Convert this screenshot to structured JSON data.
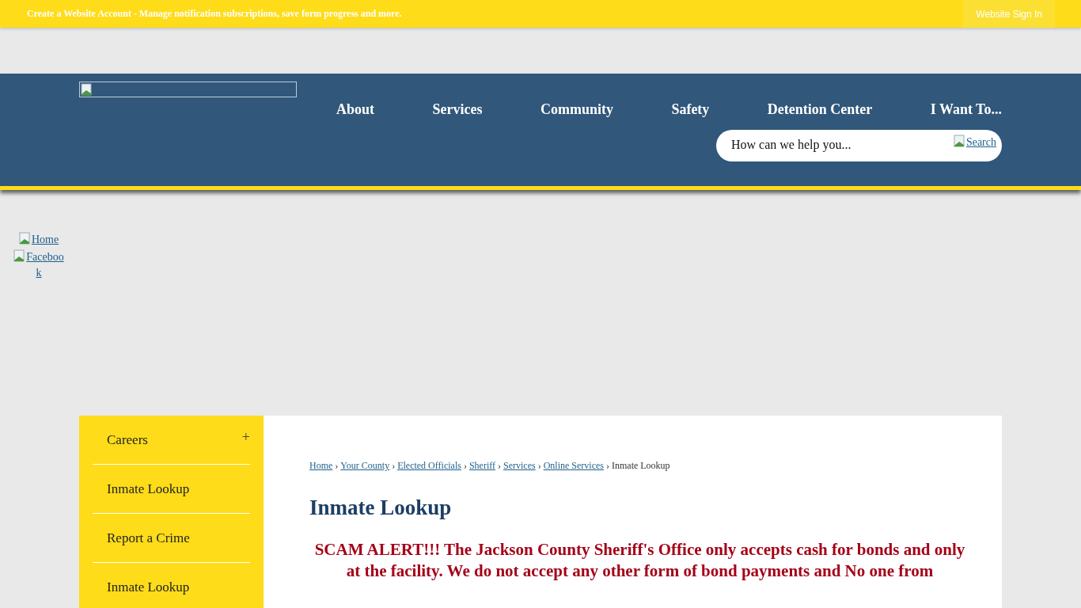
{
  "top_bar": {
    "account_link": "Create a Website Account",
    "message": " - Manage notification subscriptions, save form progress and more.",
    "sign_in_button": "Website Sign In"
  },
  "header": {
    "nav": [
      "About",
      "Services",
      "Community",
      "Safety",
      "Detention Center",
      "I Want To..."
    ],
    "search": {
      "placeholder": "How can we help you...",
      "button": "Search"
    }
  },
  "social_links": [
    "Home",
    "Facebook"
  ],
  "sidebar": {
    "items": [
      {
        "label": "Careers",
        "toggle": "+"
      },
      {
        "label": "Inmate Lookup"
      },
      {
        "label": "Report a Crime"
      },
      {
        "label": "Inmate Lookup"
      }
    ]
  },
  "breadcrumb": [
    {
      "label": "Home",
      "link": true
    },
    {
      "label": "Your County",
      "link": true
    },
    {
      "label": "Elected Officials",
      "link": true
    },
    {
      "label": "Sheriff",
      "link": true
    },
    {
      "label": "Services",
      "link": true
    },
    {
      "label": "Online Services",
      "link": true
    },
    {
      "label": "Inmate Lookup",
      "link": false
    }
  ],
  "breadcrumb_separator": "›",
  "page_title": "Inmate Lookup",
  "alert": "SCAM ALERT!!! The Jackson County Sheriff's Office only accepts cash for bonds and only at the facility. We do not accept any other form of bond payments and No one from"
}
